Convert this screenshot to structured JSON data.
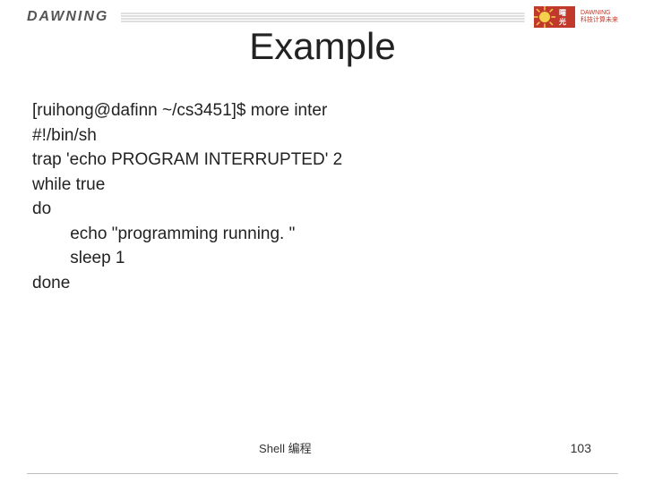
{
  "header": {
    "brand_left": "DAWNING",
    "brand_right_top": "DAWNING",
    "brand_right_sub": "科技计算未来"
  },
  "slide": {
    "title": "Example",
    "code": "[ruihong@dafinn ~/cs3451]$ more inter\n#!/bin/sh\ntrap 'echo PROGRAM INTERRUPTED' 2\nwhile true\ndo\n        echo \"programming running. \"\n        sleep 1\ndone"
  },
  "footer": {
    "label": "Shell 编程",
    "page": "103"
  }
}
